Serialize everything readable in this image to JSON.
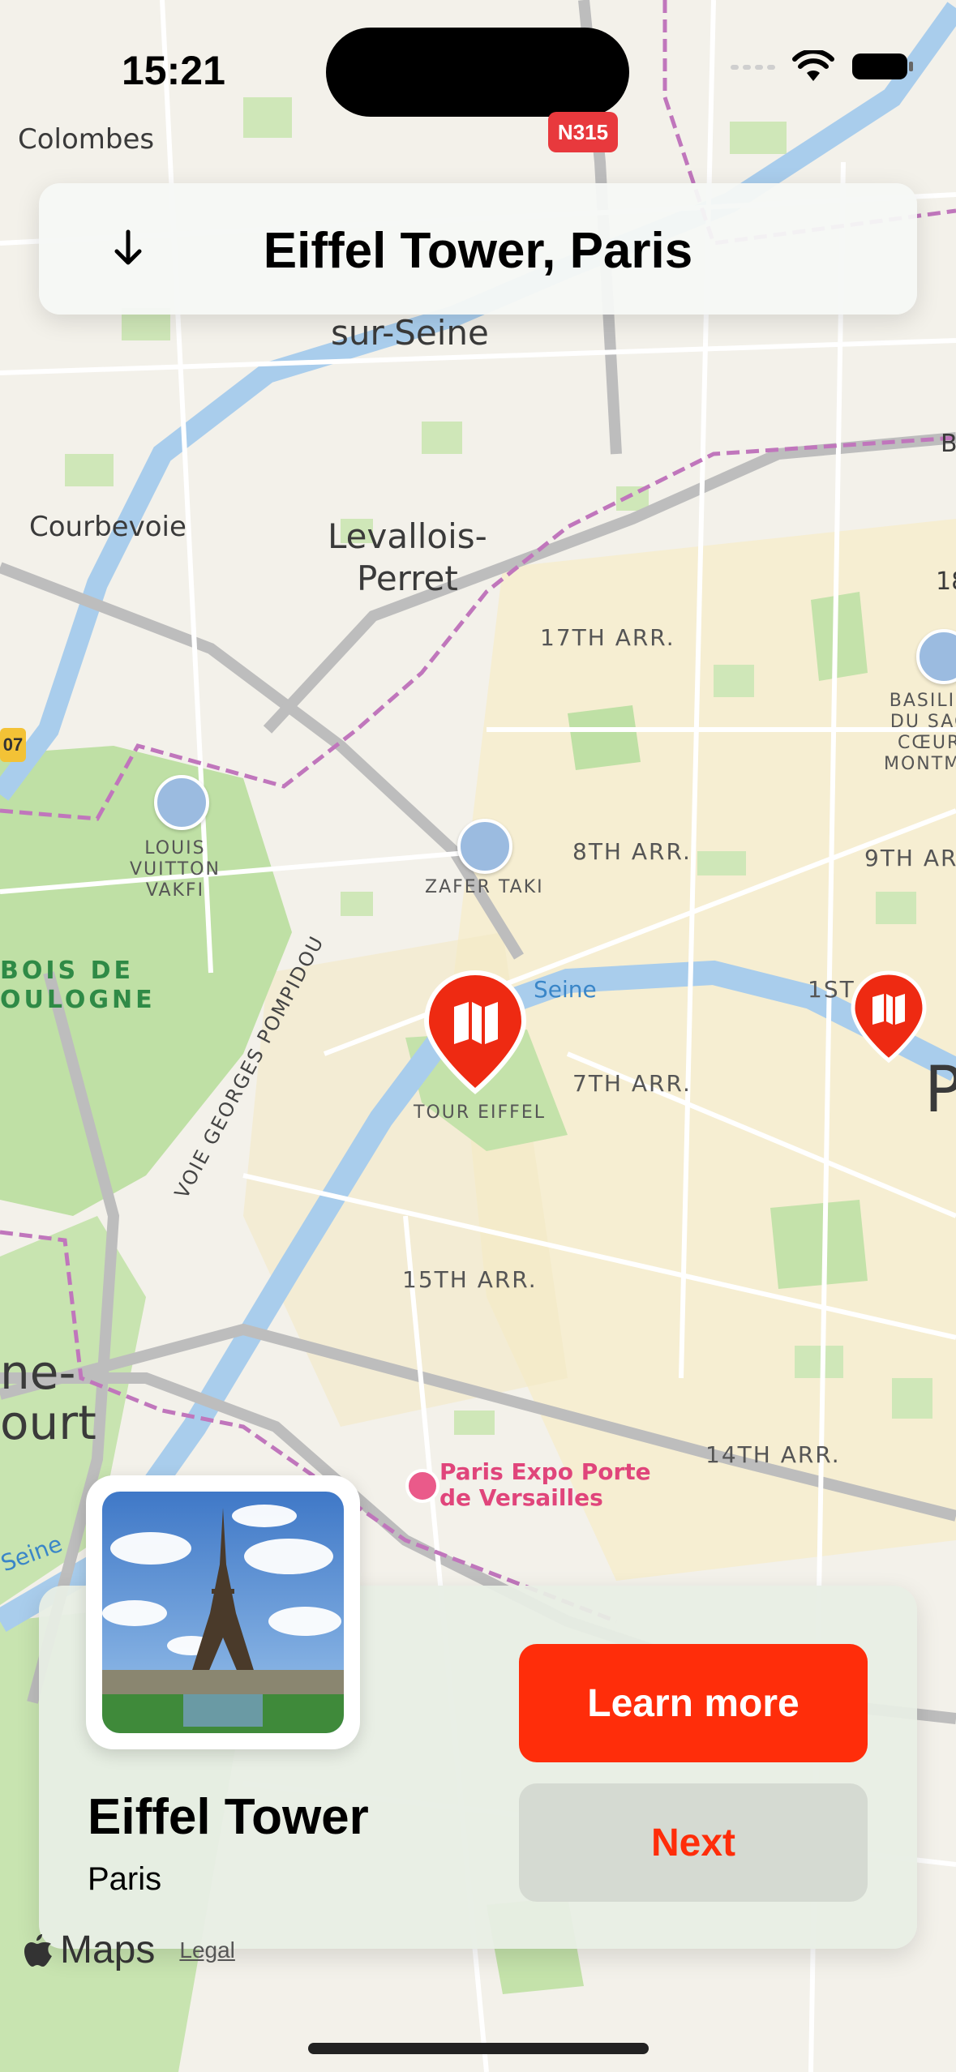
{
  "status_bar": {
    "time": "15:21"
  },
  "header": {
    "title": "Eiffel Tower, Paris"
  },
  "map": {
    "road_badge": "N315",
    "labels": {
      "colombes": "Colombes",
      "sur_seine": "sur-Seine",
      "courbevoie": "Courbevoie",
      "levallois": "Levallois-\nPerret",
      "arr17": "17TH ARR.",
      "arr8": "8TH ARR.",
      "arr9": "9TH ARR.",
      "arr7": "7TH ARR.",
      "arr15": "15TH ARR.",
      "arr14": "14TH ARR.",
      "arr1": "1ST A",
      "louis_vuitton": "LOUIS\nVUITTON\nVAKFI",
      "zafer_taki": "ZAFER TAKI",
      "tour_eiffel": "TOUR EIFFEL",
      "basilique": "BASILIC\nDU SAC\nCŒUR\nMONTMA",
      "bois": "BOIS DE\nOULOGNE",
      "seine": "Seine",
      "seine_left": "Seine",
      "voie": "VOIE GEORGES POMPIDOU",
      "paris_expo": "Paris Expo Porte\nde Versailles",
      "ne_ourt": "ne-\nourt",
      "badge_left": "07",
      "p_letter": "P",
      "b_right": "B",
      "n18": "18"
    }
  },
  "card": {
    "title": "Eiffel Tower",
    "subtitle": "Paris",
    "primary_button": "Learn more",
    "secondary_button": "Next"
  },
  "footer": {
    "maps": "Maps",
    "legal": "Legal"
  },
  "colors": {
    "accent": "#ff2d0a",
    "pin": "#ee2a12"
  }
}
